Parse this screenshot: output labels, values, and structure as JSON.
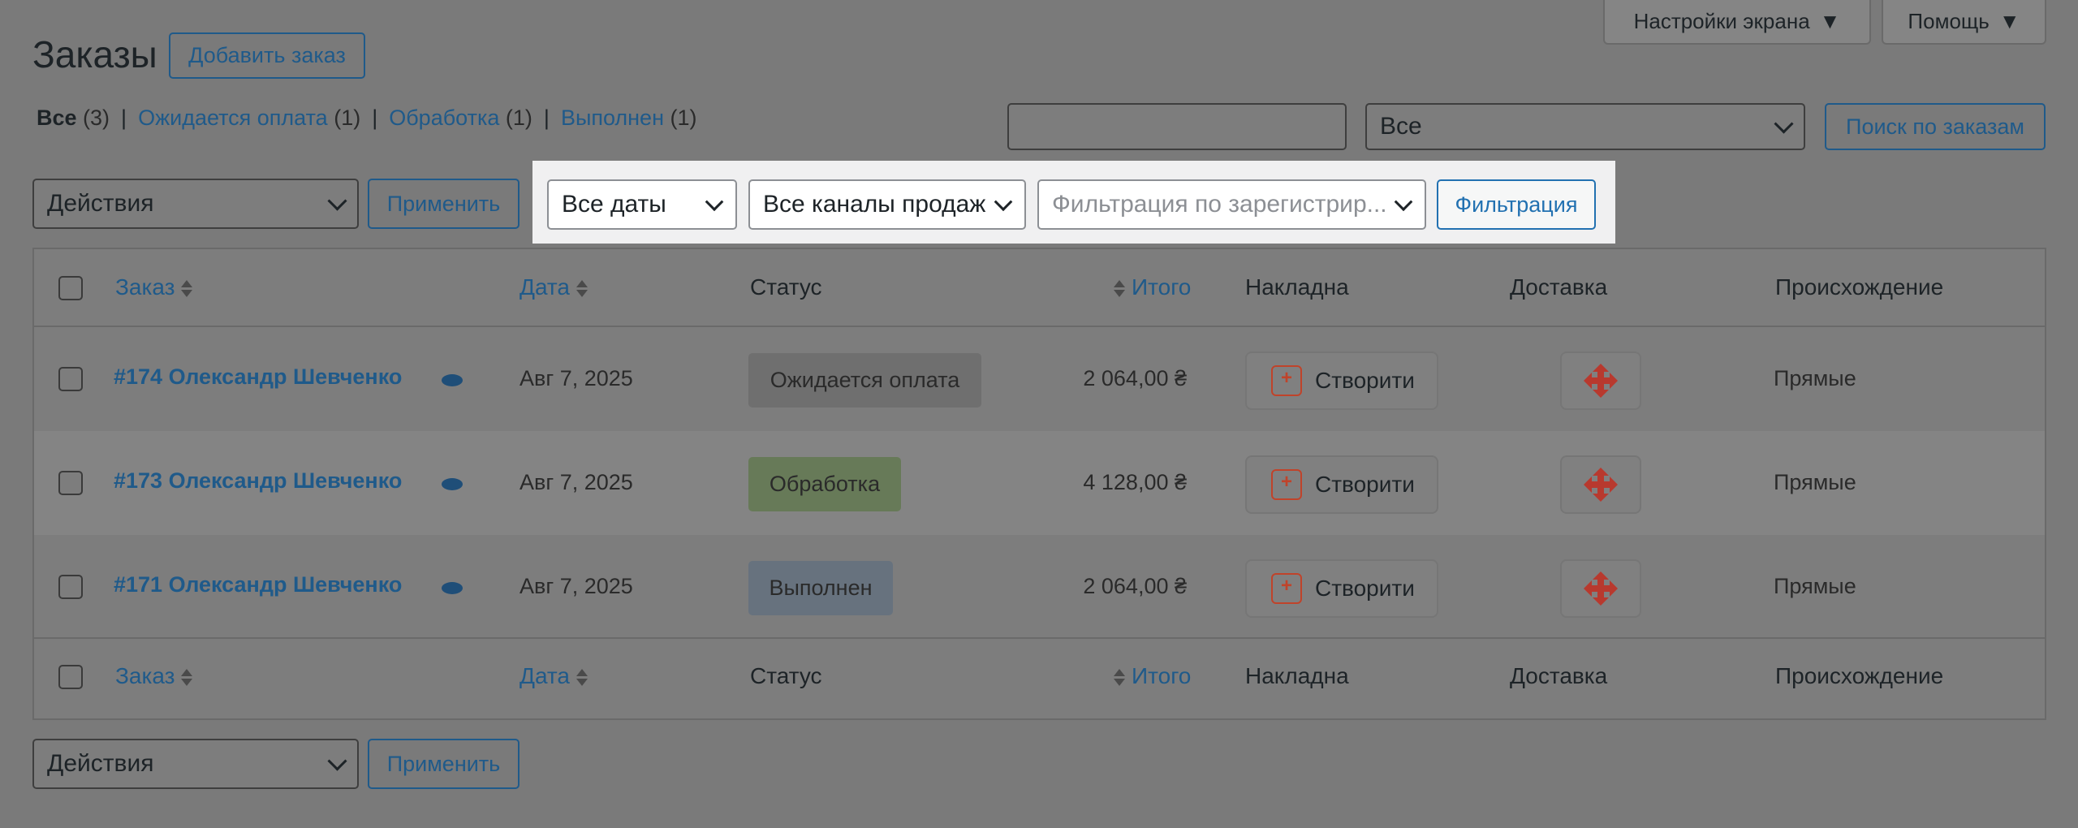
{
  "screen_options": {
    "label": "Настройки экрана"
  },
  "help": {
    "label": "Помощь"
  },
  "page_title": "Заказы",
  "add_order": "Добавить заказ",
  "filters": [
    {
      "label": "Все",
      "count": "(3)"
    },
    {
      "label": "Ожидается оплата",
      "count": "(1)"
    },
    {
      "label": "Обработка",
      "count": "(1)"
    },
    {
      "label": "Выполнен",
      "count": "(1)"
    }
  ],
  "separator": "|",
  "search": {
    "value": "",
    "status_select": "Все",
    "button": "Поиск по заказам"
  },
  "bulk": {
    "action": "Действия",
    "apply": "Применить"
  },
  "tablenav_filters": {
    "dates": "Все даты",
    "channels": "Все каналы продаж",
    "customer_placeholder": "Фильтрация по зарегистрир...",
    "filter_button": "Фильтрация"
  },
  "columns": {
    "order": "Заказ",
    "date": "Дата",
    "status": "Статус",
    "total": "Итого",
    "waybill": "Накладна",
    "shipping": "Доставка",
    "origin": "Происхождение"
  },
  "rows": [
    {
      "order": "#174 Олександр Шевченко",
      "date": "Авг 7, 2025",
      "status": "Ожидается оплата",
      "status_color": "#6f6f6f",
      "total": "2 064,00 ₴",
      "create": "Створити",
      "origin": "Прямые"
    },
    {
      "order": "#173 Олександр Шевченко",
      "date": "Авг 7, 2025",
      "status": "Обработка",
      "status_color": "#677a58",
      "total": "4 128,00 ₴",
      "create": "Створити",
      "origin": "Прямые"
    },
    {
      "order": "#171 Олександр Шевченко",
      "date": "Авг 7, 2025",
      "status": "Выполнен",
      "status_color": "#67727e",
      "total": "2 064,00 ₴",
      "create": "Створити",
      "origin": "Прямые"
    }
  ]
}
